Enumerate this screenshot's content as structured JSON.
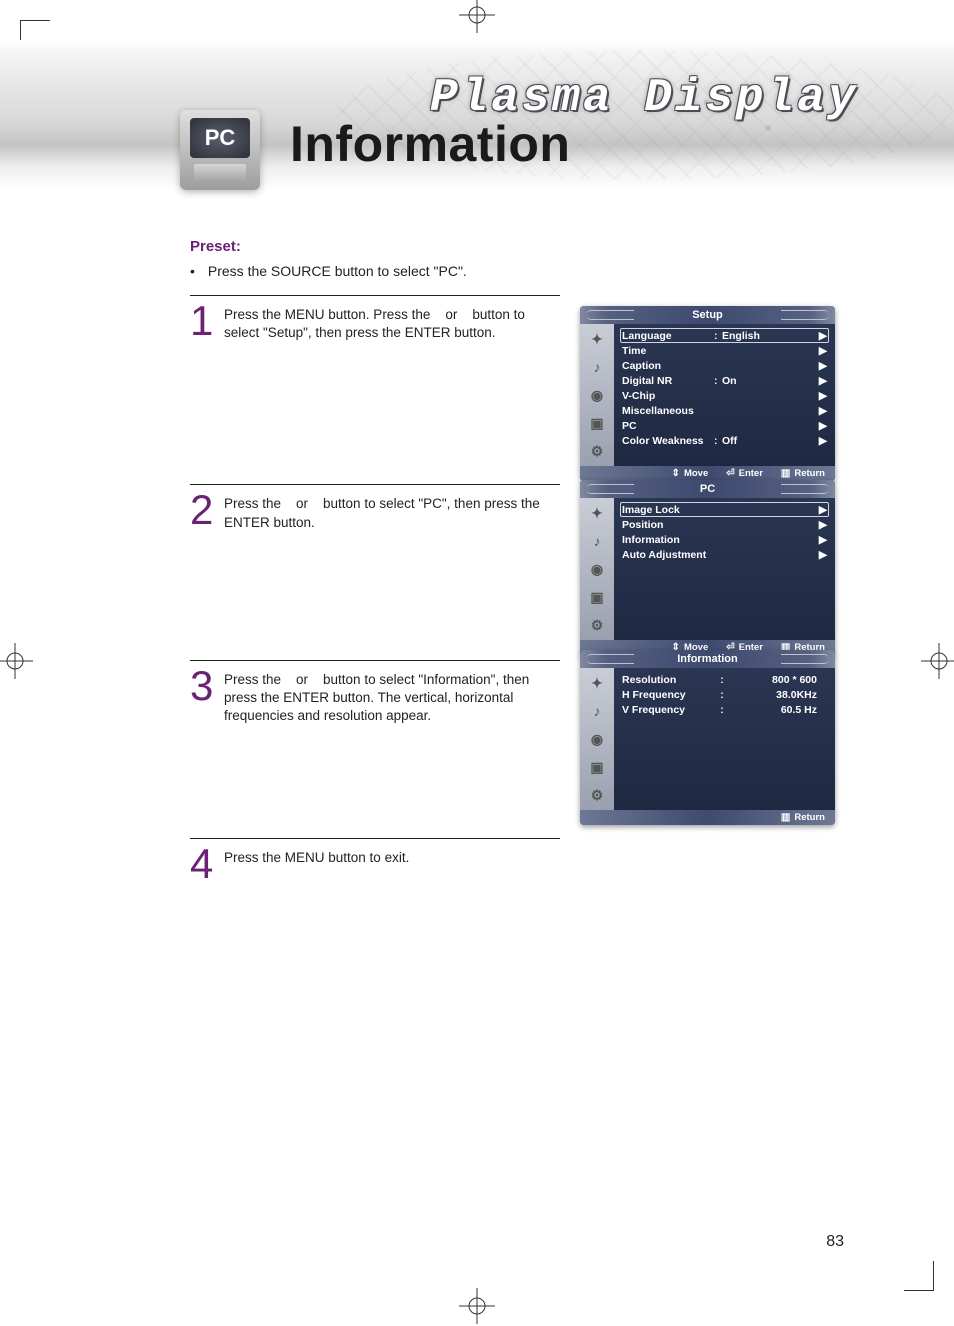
{
  "header": {
    "brand": "Plasma Display",
    "icon_label": "PC",
    "title": "Information"
  },
  "preset": {
    "heading": "Preset:",
    "bullet": "Press the SOURCE button to select \"PC\"."
  },
  "steps": {
    "s1_num": "1",
    "s1_text": "Press the MENU button. Press the    or    button to select \"Setup\", then press the ENTER button.",
    "s2_num": "2",
    "s2_text": "Press the    or    button to select \"PC\", then press the ENTER button.",
    "s3_num": "3",
    "s3_text": "Press the    or    button to select \"Information\", then press the ENTER button. The vertical, horizontal frequencies and resolution appear.",
    "s4_num": "4",
    "s4_text": "Press the MENU button to exit."
  },
  "osd_footer": {
    "move": "Move",
    "enter": "Enter",
    "return": "Return"
  },
  "osd1": {
    "title": "Setup",
    "items": [
      {
        "label": "Language",
        "colon": ":",
        "value": "English",
        "arrow": "▶"
      },
      {
        "label": "Time",
        "colon": "",
        "value": "",
        "arrow": "▶"
      },
      {
        "label": "Caption",
        "colon": "",
        "value": "",
        "arrow": "▶"
      },
      {
        "label": "Digital NR",
        "colon": ":",
        "value": "On",
        "arrow": "▶"
      },
      {
        "label": "V-Chip",
        "colon": "",
        "value": "",
        "arrow": "▶"
      },
      {
        "label": "Miscellaneous",
        "colon": "",
        "value": "",
        "arrow": "▶"
      },
      {
        "label": "PC",
        "colon": "",
        "value": "",
        "arrow": "▶"
      },
      {
        "label": "Color Weakness",
        "colon": ":",
        "value": "Off",
        "arrow": "▶"
      }
    ]
  },
  "osd2": {
    "title": "PC",
    "items": [
      {
        "label": "Image Lock",
        "arrow": "▶",
        "sel": true
      },
      {
        "label": "Position",
        "arrow": "▶"
      },
      {
        "label": "Information",
        "arrow": "▶"
      },
      {
        "label": "Auto Adjustment",
        "arrow": "▶"
      }
    ]
  },
  "osd3": {
    "title": "Information",
    "rows": [
      {
        "label": "Resolution",
        "value": "800 * 600"
      },
      {
        "label": "H Frequency",
        "value": "38.0KHz"
      },
      {
        "label": "V Frequency",
        "value": "60.5 Hz"
      }
    ]
  },
  "page_number": "83"
}
